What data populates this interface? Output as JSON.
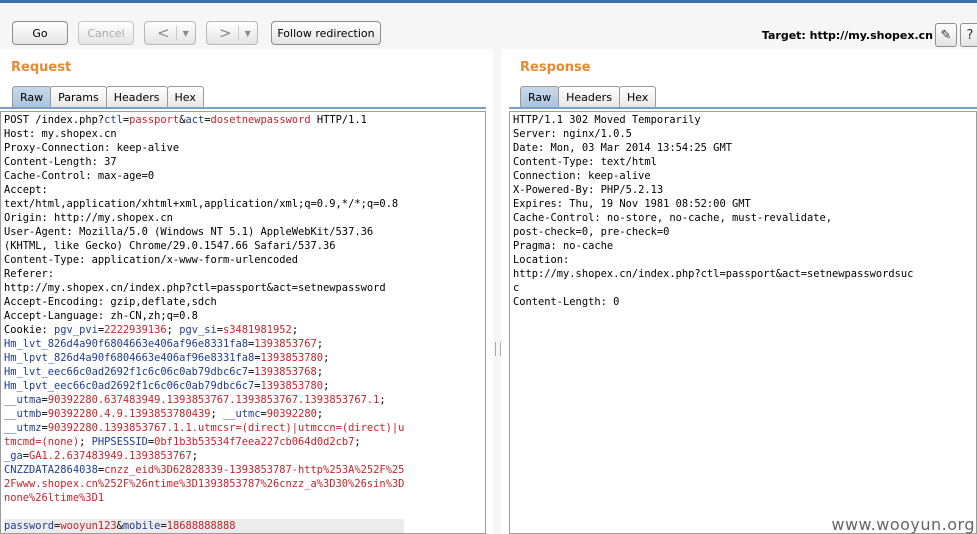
{
  "toolbar": {
    "go_label": "Go",
    "cancel_label": "Cancel",
    "back_label": "<",
    "forward_label": ">",
    "dropdown_glyph": "▼",
    "follow_label": "Follow redirection",
    "target_label": "Target: http://my.shopex.cn",
    "edit_icon": "✎",
    "help_icon": "?"
  },
  "request": {
    "title": "Request",
    "tabs": [
      "Raw",
      "Params",
      "Headers",
      "Hex"
    ],
    "active_tab": "Raw",
    "lines": [
      {
        "segs": [
          {
            "t": "POST /index.php?"
          },
          {
            "t": "ctl",
            "c": "k"
          },
          {
            "t": "="
          },
          {
            "t": "passport",
            "c": "v"
          },
          {
            "t": "&"
          },
          {
            "t": "act",
            "c": "k"
          },
          {
            "t": "="
          },
          {
            "t": "dosetnewpassword",
            "c": "v"
          },
          {
            "t": " HTTP/1.1"
          }
        ]
      },
      {
        "segs": [
          {
            "t": "Host: my.shopex.cn"
          }
        ]
      },
      {
        "segs": [
          {
            "t": "Proxy-Connection: keep-alive"
          }
        ]
      },
      {
        "segs": [
          {
            "t": "Content-Length: 37"
          }
        ]
      },
      {
        "segs": [
          {
            "t": "Cache-Control: max-age=0"
          }
        ]
      },
      {
        "segs": [
          {
            "t": "Accept:"
          }
        ]
      },
      {
        "segs": [
          {
            "t": "text/html,application/xhtml+xml,application/xml;q=0.9,*/*;q=0.8"
          }
        ]
      },
      {
        "segs": [
          {
            "t": "Origin: http://my.shopex.cn"
          }
        ]
      },
      {
        "segs": [
          {
            "t": "User-Agent: Mozilla/5.0 (Windows NT 5.1) AppleWebKit/537.36"
          }
        ]
      },
      {
        "segs": [
          {
            "t": "(KHTML, like Gecko) Chrome/29.0.1547.66 Safari/537.36"
          }
        ]
      },
      {
        "segs": [
          {
            "t": "Content-Type: application/x-www-form-urlencoded"
          }
        ]
      },
      {
        "segs": [
          {
            "t": "Referer:"
          }
        ]
      },
      {
        "segs": [
          {
            "t": "http://my.shopex.cn/index.php?ctl=passport&act=setnewpassword"
          }
        ]
      },
      {
        "segs": [
          {
            "t": "Accept-Encoding: gzip,deflate,sdch"
          }
        ]
      },
      {
        "segs": [
          {
            "t": "Accept-Language: zh-CN,zh;q=0.8"
          }
        ]
      },
      {
        "segs": [
          {
            "t": "Cookie: "
          },
          {
            "t": "pgv_pvi",
            "c": "k"
          },
          {
            "t": "="
          },
          {
            "t": "2222939136",
            "c": "v"
          },
          {
            "t": "; "
          },
          {
            "t": "pgv_si",
            "c": "k"
          },
          {
            "t": "="
          },
          {
            "t": "s3481981952",
            "c": "v"
          },
          {
            "t": ";"
          }
        ]
      },
      {
        "segs": [
          {
            "t": "Hm_lvt_826d4a90f6804663e406af96e8331fa8",
            "c": "k"
          },
          {
            "t": "="
          },
          {
            "t": "1393853767",
            "c": "v"
          },
          {
            "t": ";"
          }
        ]
      },
      {
        "segs": [
          {
            "t": "Hm_lpvt_826d4a90f6804663e406af96e8331fa8",
            "c": "k"
          },
          {
            "t": "="
          },
          {
            "t": "1393853780",
            "c": "v"
          },
          {
            "t": ";"
          }
        ]
      },
      {
        "segs": [
          {
            "t": "Hm_lvt_eec66c0ad2692f1c6c06c0ab79dbc6c7",
            "c": "k"
          },
          {
            "t": "="
          },
          {
            "t": "1393853768",
            "c": "v"
          },
          {
            "t": ";"
          }
        ]
      },
      {
        "segs": [
          {
            "t": "Hm_lpvt_eec66c0ad2692f1c6c06c0ab79dbc6c7",
            "c": "k"
          },
          {
            "t": "="
          },
          {
            "t": "1393853780",
            "c": "v"
          },
          {
            "t": ";"
          }
        ]
      },
      {
        "segs": [
          {
            "t": "__utma",
            "c": "k"
          },
          {
            "t": "="
          },
          {
            "t": "90392280.637483949.1393853767.1393853767.1393853767.1",
            "c": "v"
          },
          {
            "t": ";"
          }
        ]
      },
      {
        "segs": [
          {
            "t": "__utmb",
            "c": "k"
          },
          {
            "t": "="
          },
          {
            "t": "90392280.4.9.1393853780439",
            "c": "v"
          },
          {
            "t": "; "
          },
          {
            "t": "__utmc",
            "c": "k"
          },
          {
            "t": "="
          },
          {
            "t": "90392280",
            "c": "v"
          },
          {
            "t": ";"
          }
        ]
      },
      {
        "segs": [
          {
            "t": "__utmz",
            "c": "k"
          },
          {
            "t": "="
          },
          {
            "t": "90392280.1393853767.1.1.utmcsr=(direct)|utmccn=(direct)|u",
            "c": "v"
          }
        ]
      },
      {
        "segs": [
          {
            "t": "tmcmd=(none)",
            "c": "v"
          },
          {
            "t": "; "
          },
          {
            "t": "PHPSESSID",
            "c": "k"
          },
          {
            "t": "="
          },
          {
            "t": "0bf1b3b53534f7eea227cb064d0d2cb7",
            "c": "v"
          },
          {
            "t": ";"
          }
        ]
      },
      {
        "segs": [
          {
            "t": "_ga",
            "c": "k"
          },
          {
            "t": "="
          },
          {
            "t": "GA1.2.637483949.1393853767",
            "c": "v"
          },
          {
            "t": ";"
          }
        ]
      },
      {
        "segs": [
          {
            "t": "CNZZDATA2864038",
            "c": "k"
          },
          {
            "t": "="
          },
          {
            "t": "cnzz_eid%3D62828339-1393853787-http%253A%252F%25",
            "c": "v"
          }
        ]
      },
      {
        "segs": [
          {
            "t": "2Fwww.shopex.cn%252F%26ntime%3D1393853787%26cnzz_a%3D30%26sin%3D",
            "c": "v"
          }
        ]
      },
      {
        "segs": [
          {
            "t": "none%26ltime%3D1",
            "c": "v"
          }
        ]
      },
      {
        "segs": [
          {
            "t": ""
          }
        ]
      },
      {
        "segs": [
          {
            "t": "password",
            "c": "k"
          },
          {
            "t": "="
          },
          {
            "t": "wooyun123",
            "c": "v"
          },
          {
            "t": "&"
          },
          {
            "t": "mobile",
            "c": "k"
          },
          {
            "t": "="
          },
          {
            "t": "18688888888",
            "c": "v"
          }
        ],
        "hl": true
      }
    ]
  },
  "response": {
    "title": "Response",
    "tabs": [
      "Raw",
      "Headers",
      "Hex"
    ],
    "active_tab": "Raw",
    "lines": [
      {
        "segs": [
          {
            "t": "HTTP/1.1 302 Moved Temporarily"
          }
        ]
      },
      {
        "segs": [
          {
            "t": "Server: nginx/1.0.5"
          }
        ]
      },
      {
        "segs": [
          {
            "t": "Date: Mon, 03 Mar 2014 13:54:25 GMT"
          }
        ]
      },
      {
        "segs": [
          {
            "t": "Content-Type: text/html"
          }
        ]
      },
      {
        "segs": [
          {
            "t": "Connection: keep-alive"
          }
        ]
      },
      {
        "segs": [
          {
            "t": "X-Powered-By: PHP/5.2.13"
          }
        ]
      },
      {
        "segs": [
          {
            "t": "Expires: Thu, 19 Nov 1981 08:52:00 GMT"
          }
        ]
      },
      {
        "segs": [
          {
            "t": "Cache-Control: no-store, no-cache, must-revalidate,"
          }
        ]
      },
      {
        "segs": [
          {
            "t": "post-check=0, pre-check=0"
          }
        ]
      },
      {
        "segs": [
          {
            "t": "Pragma: no-cache"
          }
        ]
      },
      {
        "segs": [
          {
            "t": "Location:"
          }
        ]
      },
      {
        "segs": [
          {
            "t": "http://my.shopex.cn/index.php?ctl=passport&act=setnewpasswordsuc"
          }
        ]
      },
      {
        "segs": [
          {
            "t": "c"
          }
        ]
      },
      {
        "segs": [
          {
            "t": "Content-Length: 0"
          }
        ]
      }
    ]
  },
  "watermark": "www.wooyun.org"
}
